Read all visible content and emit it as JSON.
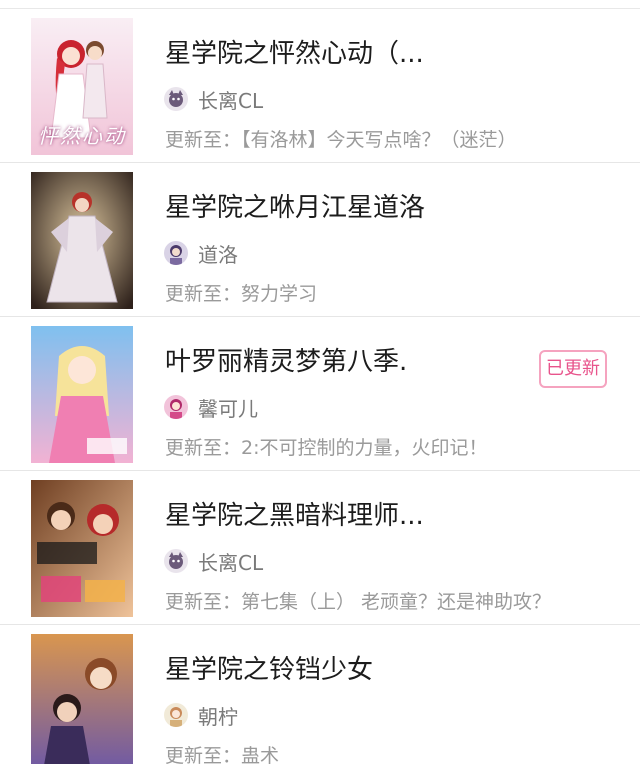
{
  "items": [
    {
      "title": "星学院之怦然心动（...",
      "author": "长离CL",
      "avatar_icon": "cat-avatar-icon",
      "update_prefix": "更新至：",
      "update_text": "【有洛林】今天写点啥？（迷茫）",
      "cover_label": "怦然心动",
      "cover_colors": [
        "#f7e6ef",
        "#f2c8da"
      ]
    },
    {
      "title": "星学院之咻月江星道洛",
      "author": "道洛",
      "avatar_icon": "character-avatar-icon",
      "update_prefix": "更新至：",
      "update_text": "努力学习",
      "cover_colors": [
        "#3a2a22",
        "#c9b089"
      ]
    },
    {
      "title": "叶罗丽精灵梦第八季.",
      "author": "馨可儿",
      "avatar_icon": "character-avatar-icon",
      "update_prefix": "更新至：",
      "update_text": "2:不可控制的力量，火印记！",
      "badge": "已更新",
      "cover_colors": [
        "#8ec5ee",
        "#f4b7d6"
      ]
    },
    {
      "title": "星学院之黑暗料理师...",
      "author": "长离CL",
      "avatar_icon": "cat-avatar-icon",
      "update_prefix": "更新至：",
      "update_text": "第七集（上） 老顽童？还是神助攻？",
      "cover_colors": [
        "#7a4a2c",
        "#e6b08a"
      ]
    },
    {
      "title": "星学院之铃铛少女",
      "author": "朝柠",
      "avatar_icon": "character-avatar-icon",
      "update_prefix": "更新至：",
      "update_text": "蛊术",
      "cover_colors": [
        "#d08a4e",
        "#7a5aa8"
      ]
    }
  ],
  "colors": {
    "title": "#1c1c1c",
    "meta": "#9a9a9a",
    "badge": "#e8548c",
    "divider": "#e6e6e6"
  }
}
